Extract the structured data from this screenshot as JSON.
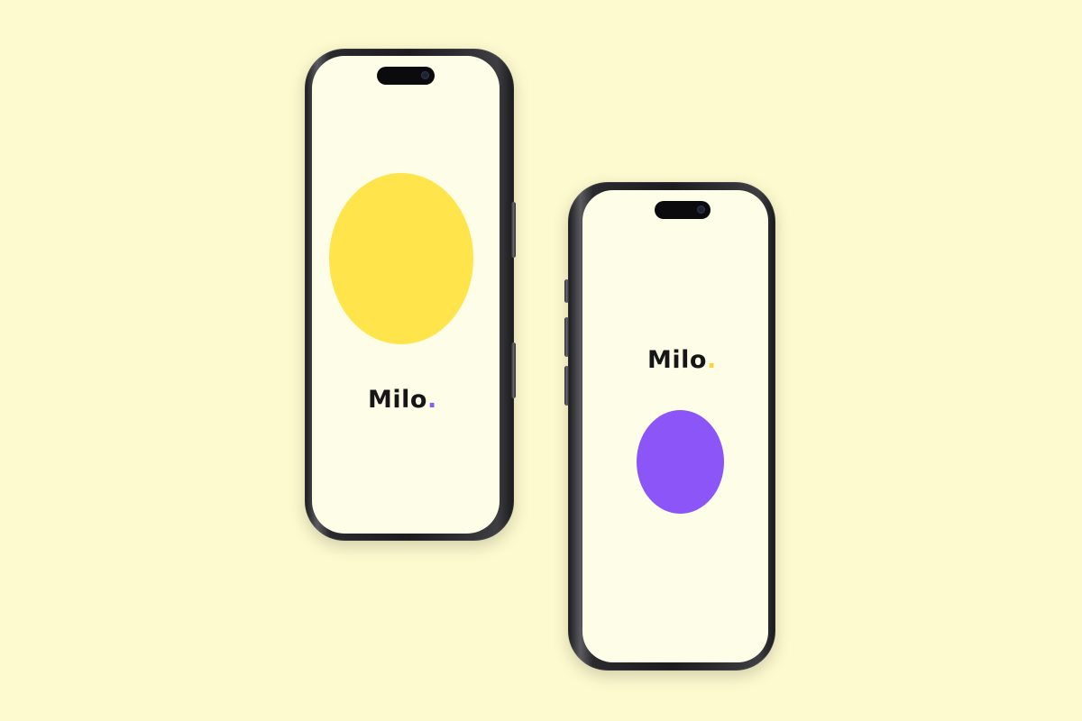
{
  "background_color": "#fdfacf",
  "screen_color": "#fefde8",
  "left_phone": {
    "brand": {
      "name": "Milo",
      "dot": ".",
      "dot_color": "#8b5cf6"
    },
    "circle_color": "#ffe44b",
    "notch_icon": "dynamic-island"
  },
  "right_phone": {
    "brand": {
      "name": "Milo",
      "dot": ".",
      "dot_color": "#ffd43a"
    },
    "circle_color": "#8b55f8",
    "notch_icon": "dynamic-island"
  }
}
